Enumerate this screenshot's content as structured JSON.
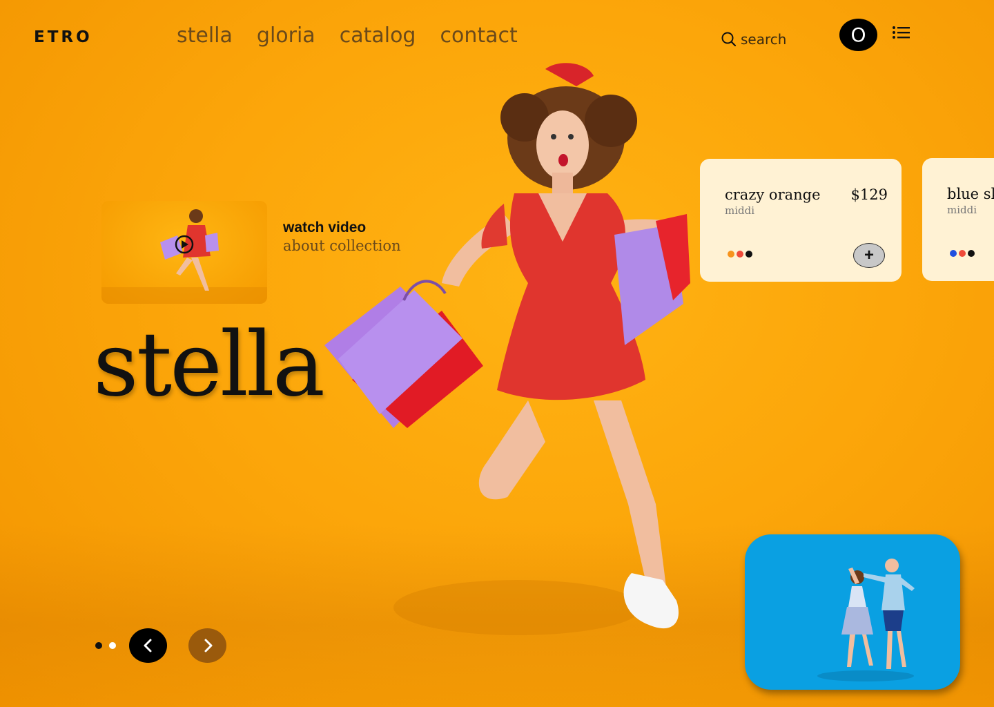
{
  "brand": {
    "logo": "ETRO"
  },
  "nav": {
    "items": [
      "stella",
      "gloria",
      "catalog",
      "contact"
    ]
  },
  "search": {
    "label": "search",
    "icon": "search-icon"
  },
  "user": {
    "avatar_letter": "O"
  },
  "menu": {
    "icon": "list-menu-icon"
  },
  "video": {
    "title": "watch video",
    "subtitle": "about collection",
    "icon": "play-icon"
  },
  "hero": {
    "headline": "stella"
  },
  "products": [
    {
      "name": "crazy orange",
      "type": "middi",
      "price": "$129",
      "colors": [
        "#f7941d",
        "#ef4b3a",
        "#111111"
      ],
      "add_label": "+"
    },
    {
      "name": "blue sk",
      "type": "middi",
      "price": "",
      "colors": [
        "#1f4fe0",
        "#ef4b3a",
        "#111111"
      ]
    }
  ],
  "slider": {
    "pages": 2,
    "active_page": 1,
    "prev_icon": "chevron-left-icon",
    "next_icon": "chevron-right-icon",
    "prev_color": "#000000",
    "next_color": "#9a5a0c"
  },
  "colors": {
    "background": "#fca60a",
    "card": "#fff2d4",
    "secondary_media": "#0aa0e2"
  }
}
